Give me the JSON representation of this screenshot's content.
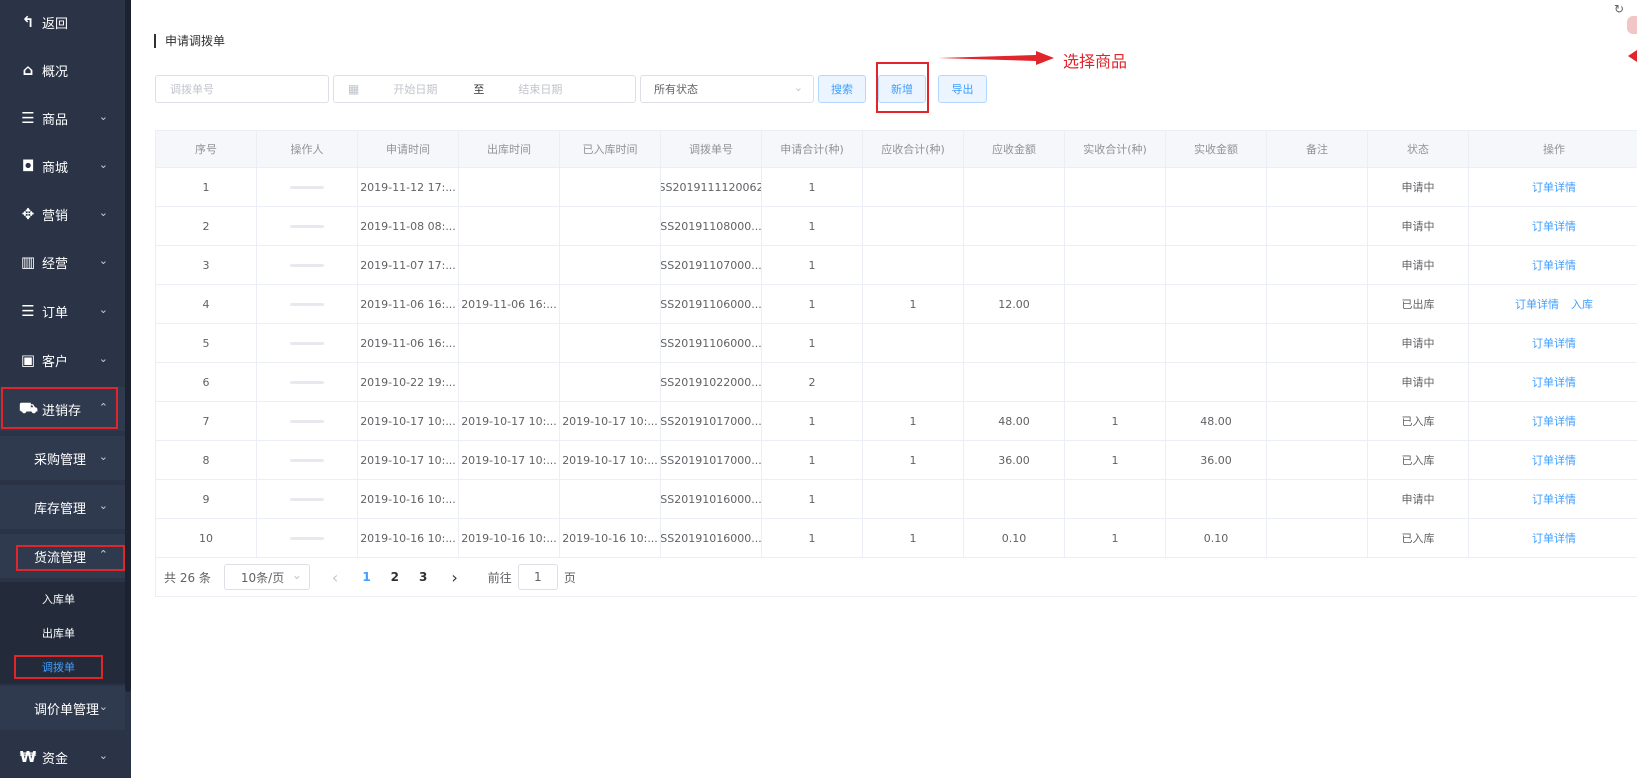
{
  "sidebar": {
    "back": {
      "label": "返回",
      "icon": "back-arrow-icon"
    },
    "overview": {
      "label": "概况",
      "icon": "home-icon"
    },
    "goods": {
      "label": "商品",
      "icon": "list-icon"
    },
    "mall": {
      "label": "商城",
      "icon": "shopping-bag-icon"
    },
    "marketing": {
      "label": "营销",
      "icon": "gift-icon"
    },
    "business": {
      "label": "经营",
      "icon": "bar-chart-icon"
    },
    "orders": {
      "label": "订单",
      "icon": "list-icon"
    },
    "customers": {
      "label": "客户",
      "icon": "id-card-icon"
    },
    "inventory": {
      "label": "进销存",
      "icon": "truck-icon"
    },
    "purchase": {
      "label": "采购管理"
    },
    "stock": {
      "label": "库存管理"
    },
    "logistics": {
      "label": "货流管理"
    },
    "inbound": {
      "label": "入库单"
    },
    "outbound": {
      "label": "出库单"
    },
    "transfer": {
      "label": "调拨单"
    },
    "price_adjust": {
      "label": "调价单管理"
    },
    "funds": {
      "label": "资金",
      "icon": "won-icon"
    }
  },
  "page": {
    "title": "申请调拨单"
  },
  "filters": {
    "order_no_placeholder": "调拨单号",
    "start_date_placeholder": "开始日期",
    "range_separator": "至",
    "end_date_placeholder": "结束日期",
    "status_value": "所有状态",
    "search_label": "搜索",
    "add_label": "新增",
    "export_label": "导出"
  },
  "annotation": {
    "text": "选择商品",
    "color": "#e0252b"
  },
  "table": {
    "headers": [
      "序号",
      "操作人",
      "申请时间",
      "出库时间",
      "已入库时间",
      "调拨单号",
      "申请合计(种)",
      "应收合计(种)",
      "应收金额",
      "实收合计(种)",
      "实收金额",
      "备注",
      "状态",
      "操作"
    ],
    "rows": [
      {
        "no": "1",
        "apply": "2019-11-12 17:...",
        "out": "",
        "in": "",
        "order": "SS2019111120062",
        "req": "1",
        "due": "",
        "due_amt": "",
        "act": "",
        "act_amt": "",
        "remark": "",
        "status": "申请中",
        "ops": [
          "订单详情"
        ]
      },
      {
        "no": "2",
        "apply": "2019-11-08 08:...",
        "out": "",
        "in": "",
        "order": "SS20191108000...",
        "req": "1",
        "due": "",
        "due_amt": "",
        "act": "",
        "act_amt": "",
        "remark": "",
        "status": "申请中",
        "ops": [
          "订单详情"
        ]
      },
      {
        "no": "3",
        "apply": "2019-11-07 17:...",
        "out": "",
        "in": "",
        "order": "SS20191107000...",
        "req": "1",
        "due": "",
        "due_amt": "",
        "act": "",
        "act_amt": "",
        "remark": "",
        "status": "申请中",
        "ops": [
          "订单详情"
        ]
      },
      {
        "no": "4",
        "apply": "2019-11-06 16:...",
        "out": "2019-11-06 16:...",
        "in": "",
        "order": "SS20191106000...",
        "req": "1",
        "due": "1",
        "due_amt": "12.00",
        "act": "",
        "act_amt": "",
        "remark": "",
        "status": "已出库",
        "ops": [
          "订单详情",
          "入库"
        ]
      },
      {
        "no": "5",
        "apply": "2019-11-06 16:...",
        "out": "",
        "in": "",
        "order": "SS20191106000...",
        "req": "1",
        "due": "",
        "due_amt": "",
        "act": "",
        "act_amt": "",
        "remark": "",
        "status": "申请中",
        "ops": [
          "订单详情"
        ]
      },
      {
        "no": "6",
        "apply": "2019-10-22 19:...",
        "out": "",
        "in": "",
        "order": "SS20191022000...",
        "req": "2",
        "due": "",
        "due_amt": "",
        "act": "",
        "act_amt": "",
        "remark": "",
        "status": "申请中",
        "ops": [
          "订单详情"
        ]
      },
      {
        "no": "7",
        "apply": "2019-10-17 10:...",
        "out": "2019-10-17 10:...",
        "in": "2019-10-17 10:...",
        "order": "SS20191017000...",
        "req": "1",
        "due": "1",
        "due_amt": "48.00",
        "act": "1",
        "act_amt": "48.00",
        "remark": "",
        "status": "已入库",
        "ops": [
          "订单详情"
        ]
      },
      {
        "no": "8",
        "apply": "2019-10-17 10:...",
        "out": "2019-10-17 10:...",
        "in": "2019-10-17 10:...",
        "order": "SS20191017000...",
        "req": "1",
        "due": "1",
        "due_amt": "36.00",
        "act": "1",
        "act_amt": "36.00",
        "remark": "",
        "status": "已入库",
        "ops": [
          "订单详情"
        ]
      },
      {
        "no": "9",
        "apply": "2019-10-16 10:...",
        "out": "",
        "in": "",
        "order": "SS20191016000...",
        "req": "1",
        "due": "",
        "due_amt": "",
        "act": "",
        "act_amt": "",
        "remark": "",
        "status": "申请中",
        "ops": [
          "订单详情"
        ]
      },
      {
        "no": "10",
        "apply": "2019-10-16 10:...",
        "out": "2019-10-16 10:...",
        "in": "2019-10-16 10:...",
        "order": "SS20191016000...",
        "req": "1",
        "due": "1",
        "due_amt": "0.10",
        "act": "1",
        "act_amt": "0.10",
        "remark": "",
        "status": "已入库",
        "ops": [
          "订单详情"
        ]
      }
    ]
  },
  "pagination": {
    "total": "共 26 条",
    "page_size": "10条/页",
    "prev": "‹",
    "next": "›",
    "pages": [
      "1",
      "2",
      "3"
    ],
    "current": "1",
    "goto_prefix": "前往",
    "goto_value": "1",
    "goto_suffix": "页"
  },
  "colors": {
    "sidebar_bg": "#2b3446",
    "accent": "#409eff",
    "highlight": "#e0252b"
  }
}
